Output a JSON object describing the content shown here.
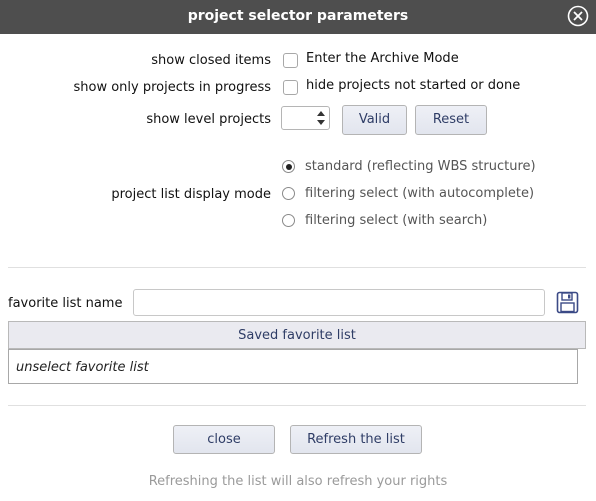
{
  "dialog": {
    "title": "project selector parameters"
  },
  "options": {
    "show_closed_label": "show closed items",
    "archive_mode_label": "Enter the Archive Mode",
    "show_in_progress_label": "show only projects in progress",
    "hide_not_started_label": "hide projects not started or done",
    "show_level_label": "show level projects",
    "level_value": "",
    "valid_button": "Valid",
    "reset_button": "Reset",
    "display_mode_label": "project list display mode",
    "display_modes": [
      {
        "label": "standard (reflecting WBS structure)",
        "selected": true
      },
      {
        "label": "filtering select (with autocomplete)",
        "selected": false
      },
      {
        "label": "filtering select (with search)",
        "selected": false
      }
    ]
  },
  "favorites": {
    "name_label": "favorite list name",
    "name_value": "",
    "saved_header": "Saved favorite list",
    "items": [
      "unselect favorite list"
    ],
    "save_icon": "floppy-disk-icon"
  },
  "footer": {
    "close_button": "close",
    "refresh_button": "Refresh the list",
    "note": "Refreshing the list will also refresh your rights"
  },
  "colors": {
    "titlebar": "#4e4e4e",
    "button_text": "#2f3d66",
    "save_icon": "#3b4a86"
  }
}
